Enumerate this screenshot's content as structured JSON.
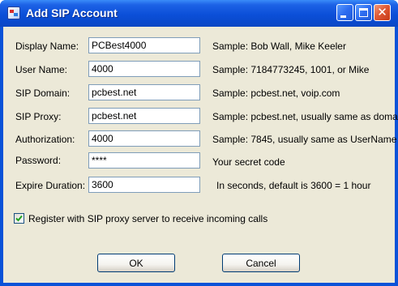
{
  "window": {
    "title": "Add SIP Account",
    "icon": "app-icon",
    "controls": {
      "minimize": "minimize-icon",
      "maximize": "maximize-icon",
      "close": "close-icon",
      "close_glyph": "✕"
    },
    "colors": {
      "titlebar": "#0a4fd8",
      "client_bg": "#ece9d8",
      "close_button": "#e05a36"
    }
  },
  "form": {
    "display_name": {
      "label": "Display Name:",
      "value": "PCBest4000",
      "sample": "Sample: Bob Wall, Mike Keeler"
    },
    "user_name": {
      "label": "User Name:",
      "value": "4000",
      "sample": "Sample: 7184773245, 1001, or Mike"
    },
    "sip_domain": {
      "label": "SIP Domain:",
      "value": "pcbest.net",
      "sample": "Sample: pcbest.net, voip.com"
    },
    "sip_proxy": {
      "label": "SIP Proxy:",
      "value": "pcbest.net",
      "sample": "Sample: pcbest.net, usually same as domain"
    },
    "authorization": {
      "label": "Authorization:",
      "value": "4000",
      "sample": "Sample: 7845, usually same as UserName"
    },
    "password": {
      "label": "Password:",
      "value": "****",
      "sample": "Your secret code"
    },
    "expire_duration": {
      "label": "Expire Duration:",
      "value": "3600",
      "sample": "In seconds, default is 3600 = 1 hour"
    }
  },
  "register_checkbox": {
    "label": "Register with SIP proxy server to receive incoming calls",
    "checked": true
  },
  "buttons": {
    "ok": "OK",
    "cancel": "Cancel"
  }
}
